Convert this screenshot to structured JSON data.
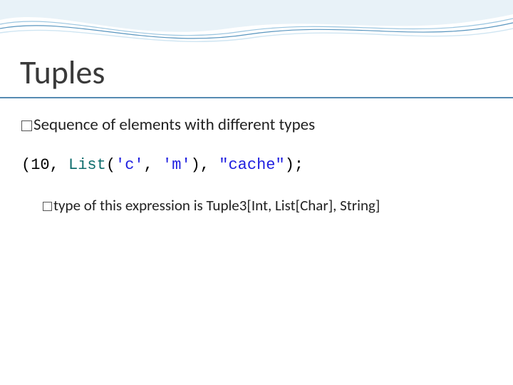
{
  "slide": {
    "title": "Tuples",
    "bullet1": "Sequence of elements with different types",
    "code": {
      "open": "(",
      "ten": "10",
      "comma1": ", ",
      "list": "List",
      "lparen": "(",
      "char_c": "'c'",
      "comma2": ", ",
      "char_m": "'m'",
      "rparen": ")",
      "comma3": ", ",
      "cache": "\"cache\"",
      "close": ");"
    },
    "bullet2": "type of this expression is Tuple3[Int, List[Char], String]"
  },
  "decoration": {
    "wave_color_light": "#cfe5f2",
    "wave_color_mid": "#9cc6e0",
    "wave_color_line": "#5a96bf",
    "underline_color": "#568bb2"
  }
}
